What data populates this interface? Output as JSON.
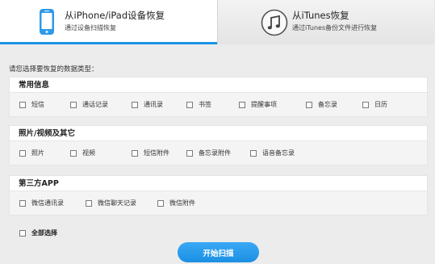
{
  "tabs": [
    {
      "title": "从iPhone/iPad设备恢复",
      "subtitle": "通过设备扫描恢复",
      "icon": "iphone-icon"
    },
    {
      "title": "从iTunes恢复",
      "subtitle": "通过iTunes备份文件进行恢复",
      "icon": "itunes-music-icon"
    }
  ],
  "prompt": "请您选择要恢复的数据类型：",
  "groups": [
    {
      "title": "常用信息",
      "options": [
        "短信",
        "通话记录",
        "通讯录",
        "书签",
        "提醒事项",
        "备忘录",
        "日历"
      ]
    },
    {
      "title": "照片/视频及其它",
      "options": [
        "照片",
        "视频",
        "短信附件",
        "备忘录附件",
        "语音备忘录"
      ]
    },
    {
      "title": "第三方APP",
      "options": [
        "微信通讯录",
        "微信聊天记录",
        "微信附件"
      ]
    }
  ],
  "select_all": "全部选择",
  "start_button": "开始扫描",
  "colors": {
    "accent": "#1a93e6",
    "button": "#2a9cee"
  }
}
